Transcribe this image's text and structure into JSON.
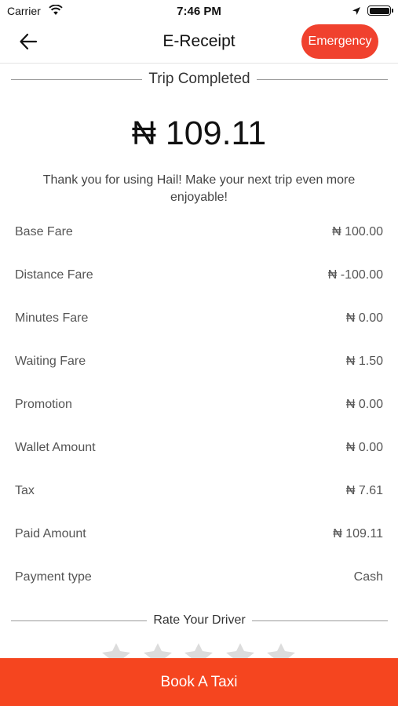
{
  "status_bar": {
    "carrier": "Carrier",
    "time": "7:46 PM"
  },
  "header": {
    "title": "E-Receipt",
    "emergency_label": "Emergency",
    "back_icon": "arrow-left-icon"
  },
  "trip_section": {
    "label": "Trip Completed"
  },
  "total_amount": "₦ 109.11",
  "thanks_message": "Thank you for using Hail! Make your next trip even more enjoyable!",
  "fare_rows": [
    {
      "label": "Base Fare",
      "value": "₦ 100.00"
    },
    {
      "label": "Distance Fare",
      "value": "₦ -100.00"
    },
    {
      "label": "Minutes Fare",
      "value": "₦ 0.00"
    },
    {
      "label": "Waiting Fare",
      "value": "₦ 1.50"
    },
    {
      "label": "Promotion",
      "value": "₦ 0.00"
    },
    {
      "label": "Wallet Amount",
      "value": "₦ 0.00"
    },
    {
      "label": "Tax",
      "value": "₦ 7.61"
    },
    {
      "label": "Paid Amount",
      "value": "₦ 109.11"
    },
    {
      "label": "Payment type",
      "value": "Cash"
    }
  ],
  "rating_section": {
    "label": "Rate Your Driver",
    "max_stars": 5,
    "rating": 0
  },
  "book_button": {
    "label": "Book A Taxi"
  },
  "colors": {
    "accent": "#f5451f",
    "emergency": "#f0412e"
  }
}
